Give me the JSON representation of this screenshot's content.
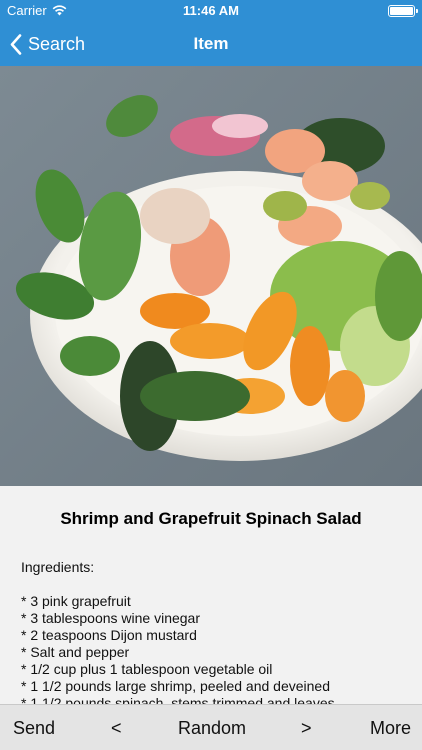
{
  "status_bar": {
    "carrier": "Carrier",
    "time": "11:46 AM",
    "battery_level": 1.0
  },
  "nav": {
    "back_label": "Search",
    "title": "Item"
  },
  "photo": {
    "description_icon": "salad-photo"
  },
  "recipe": {
    "title": "Shrimp and Grapefruit Spinach Salad",
    "ingredients_label": "Ingredients:",
    "ingredients": [
      "* 3 pink grapefruit",
      "* 3 tablespoons wine vinegar",
      "* 2 teaspoons Dijon mustard",
      "* Salt and pepper",
      "* 1/2 cup plus 1 tablespoon vegetable oil",
      "* 1 1/2 pounds large shrimp, peeled and deveined",
      "* 1 1/2 pounds spinach, stems trimmed and leaves"
    ]
  },
  "toolbar": {
    "send": "Send",
    "prev": "<",
    "random": "Random",
    "next": ">",
    "more": "More"
  },
  "colors": {
    "nav": "#2f8fd4",
    "toolbar": "#e4e4e4"
  }
}
